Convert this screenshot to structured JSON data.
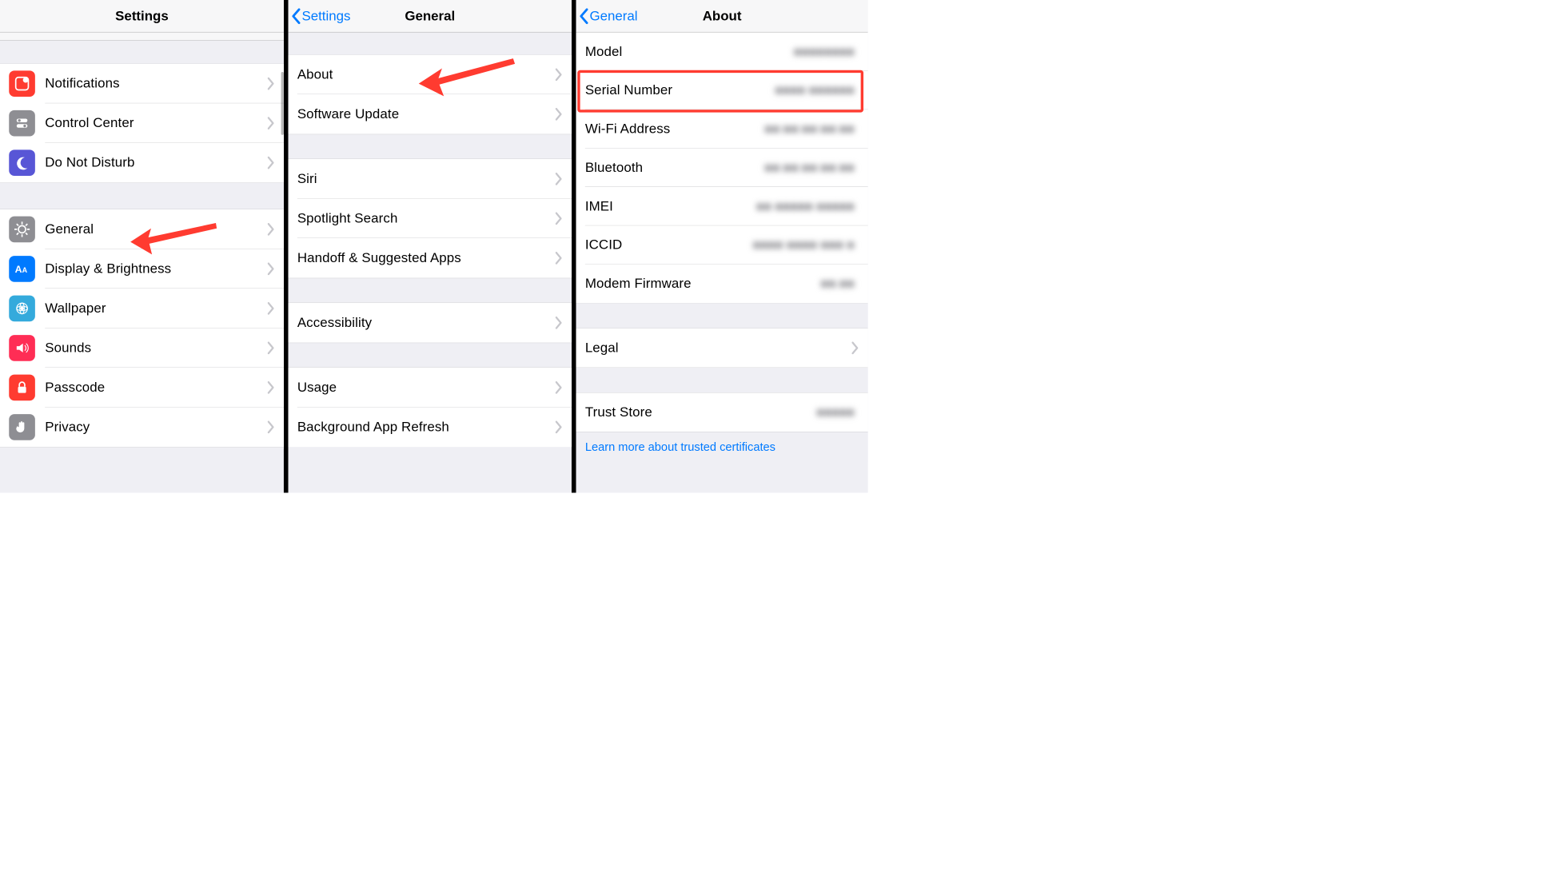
{
  "panel1": {
    "title": "Settings",
    "groups": [
      [
        {
          "label": "Notifications",
          "icon": "notifications",
          "bg": "bg-red"
        },
        {
          "label": "Control Center",
          "icon": "control-center",
          "bg": "bg-gray"
        },
        {
          "label": "Do Not Disturb",
          "icon": "moon",
          "bg": "bg-purple"
        }
      ],
      [
        {
          "label": "General",
          "icon": "gear",
          "bg": "bg-gray"
        },
        {
          "label": "Display & Brightness",
          "icon": "display",
          "bg": "bg-blue"
        },
        {
          "label": "Wallpaper",
          "icon": "wallpaper",
          "bg": "bg-cyan"
        },
        {
          "label": "Sounds",
          "icon": "sounds",
          "bg": "bg-red"
        },
        {
          "label": "Passcode",
          "icon": "lock",
          "bg": "bg-red"
        },
        {
          "label": "Privacy",
          "icon": "hand",
          "bg": "bg-darkgray"
        }
      ]
    ]
  },
  "panel2": {
    "back": "Settings",
    "title": "General",
    "groups": [
      [
        "About",
        "Software Update"
      ],
      [
        "Siri",
        "Spotlight Search",
        "Handoff & Suggested Apps"
      ],
      [
        "Accessibility"
      ],
      [
        "Usage",
        "Background App Refresh"
      ]
    ]
  },
  "panel3": {
    "back": "General",
    "title": "About",
    "rows_top": [
      {
        "label": "Model",
        "value_placeholder": "■■■■■■■■",
        "chevron": false
      },
      {
        "label": "Serial Number",
        "value_placeholder": "■■■■ ■■■■■■",
        "chevron": false,
        "highlighted": true
      },
      {
        "label": "Wi-Fi Address",
        "value_placeholder": "■■:■■:■■:■■:■■",
        "chevron": false
      },
      {
        "label": "Bluetooth",
        "value_placeholder": "■■:■■:■■:■■:■■",
        "chevron": false
      },
      {
        "label": "IMEI",
        "value_placeholder": "■■ ■■■■■ ■■■■■",
        "chevron": false
      },
      {
        "label": "ICCID",
        "value_placeholder": "■■■■ ■■■■ ■■■ ■",
        "chevron": false
      },
      {
        "label": "Modem Firmware",
        "value_placeholder": "■■.■■",
        "chevron": false
      }
    ],
    "legal": {
      "label": "Legal"
    },
    "trust": {
      "label": "Trust Store",
      "value_placeholder": "■■■■■"
    },
    "learn_more": "Learn more about trusted certificates"
  }
}
